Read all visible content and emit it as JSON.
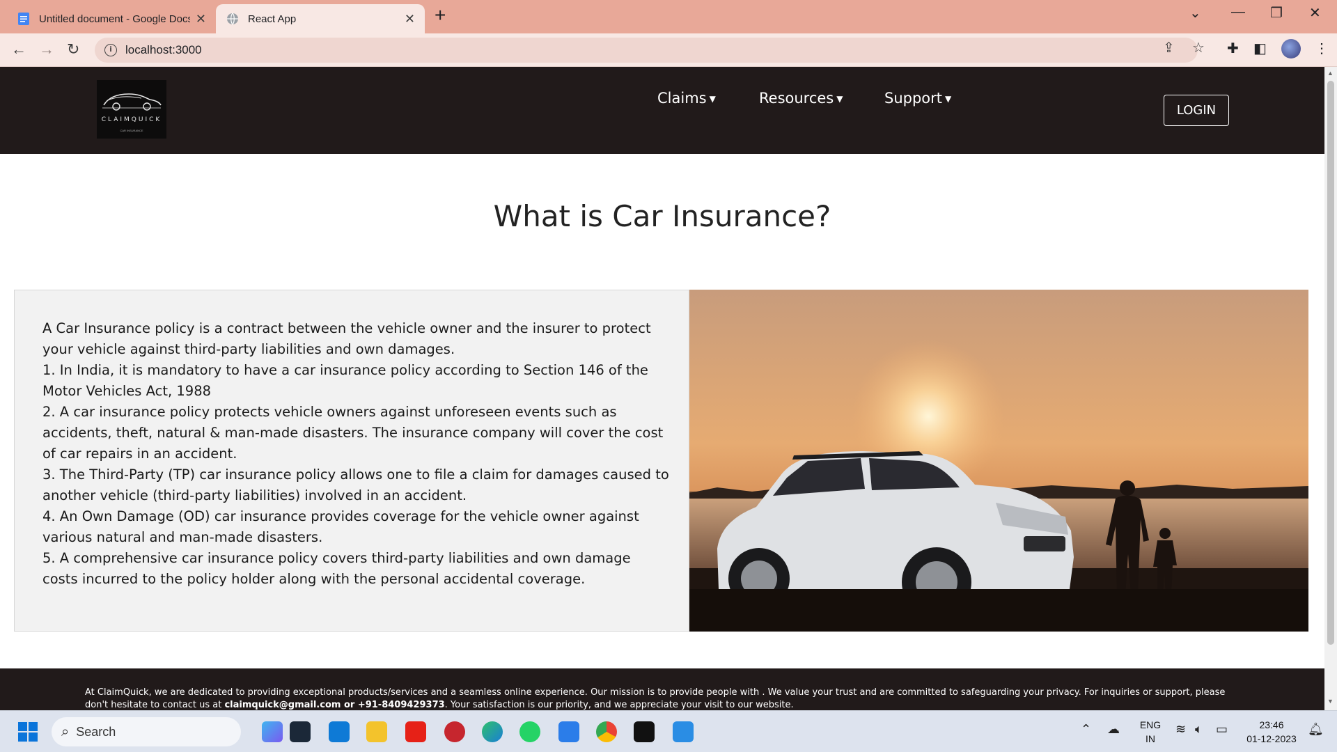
{
  "browser": {
    "tabs": [
      {
        "title": "Untitled document - Google Docs",
        "icon": "google-docs-icon",
        "active": false
      },
      {
        "title": "React App",
        "icon": "globe-icon",
        "active": true
      }
    ],
    "url": "localhost:3000"
  },
  "site": {
    "logo": {
      "brand": "CLAIMQUICK",
      "tagline": "CAR INSURANCE"
    },
    "menu": [
      "Claims",
      "Resources",
      "Support"
    ],
    "login_label": "LOGIN",
    "heading": "What is Car Insurance?",
    "paragraphs": [
      "A Car Insurance policy is a contract between the vehicle owner and the insurer to protect your vehicle against third-party liabilities and own damages.",
      "1. In India, it is mandatory to have a car insurance policy according to Section 146 of the Motor Vehicles Act, 1988",
      "2. A car insurance policy protects vehicle owners against unforeseen events such as accidents, theft, natural & man-made disasters. The insurance company will cover the cost of car repairs in an accident.",
      "3. The Third-Party (TP) car insurance policy allows one to file a claim for damages caused to another vehicle (third-party liabilities) involved in an accident.",
      "4. An Own Damage (OD) car insurance provides coverage for the vehicle owner against various natural and man-made disasters.",
      "5. A comprehensive car insurance policy covers third-party liabilities and own damage costs incurred to the policy holder along with the personal accidental coverage."
    ],
    "footer_text_1": "At ClaimQuick, we are dedicated to providing exceptional products/services and a seamless online experience. Our mission is to provide people with . We value your trust and are committed to safeguarding your privacy. For inquiries or support, please don't hesitate to contact us at ",
    "footer_contact": "claimquick@gmail.com or +91-8409429373",
    "footer_text_2": ". Your satisfaction is our priority, and we appreciate your visit to our website."
  },
  "taskbar": {
    "search_label": "Search",
    "lang": [
      "ENG",
      "IN"
    ],
    "time": "23:46",
    "date": "01-12-2023"
  },
  "colors": {
    "tabstrip": "#e8a898",
    "navbar": "#211a1a",
    "card": "#f2f2f2"
  }
}
